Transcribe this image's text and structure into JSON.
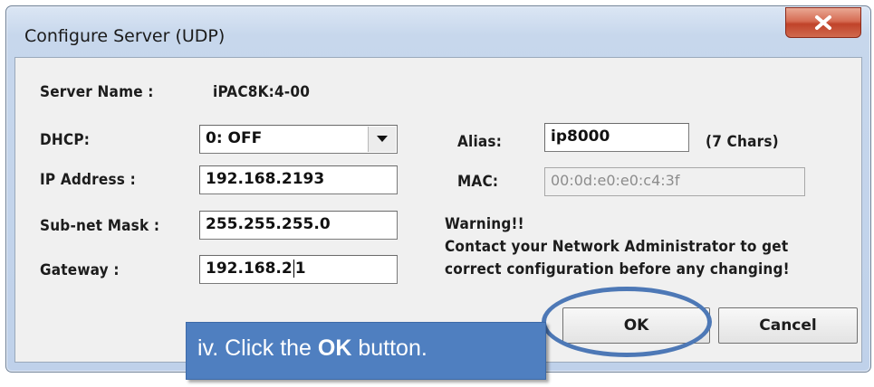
{
  "window": {
    "title": "Configure Server (UDP)",
    "close_icon": "close-icon"
  },
  "server": {
    "name_label": "Server Name :",
    "name_value": "iPAC8K:4-00"
  },
  "form": {
    "dhcp_label": "DHCP:",
    "dhcp_value": "0: OFF",
    "ip_label": "IP Address :",
    "ip_value": "192.168.2193",
    "mask_label": "Sub-net Mask :",
    "mask_value": "255.255.255.0",
    "gateway_label": "Gateway :",
    "gateway_value_a": "192.168.2",
    "gateway_value_b": "1",
    "alias_label": "Alias:",
    "alias_value": "ip8000",
    "alias_hint": "(7 Chars)",
    "mac_label": "MAC:",
    "mac_value": "00:0d:e0:e0:c4:3f"
  },
  "warning": {
    "title": "Warning!!",
    "line1": "Contact your Network Administrator to get",
    "line2": "correct  configuration before any changing!"
  },
  "buttons": {
    "ok": "OK",
    "cancel": "Cancel"
  },
  "callout": {
    "prefix": "iv. Click the ",
    "bold": "OK",
    "suffix": " button."
  },
  "colors": {
    "annotation": "#4f7fc0",
    "close_button": "#c8472f"
  }
}
